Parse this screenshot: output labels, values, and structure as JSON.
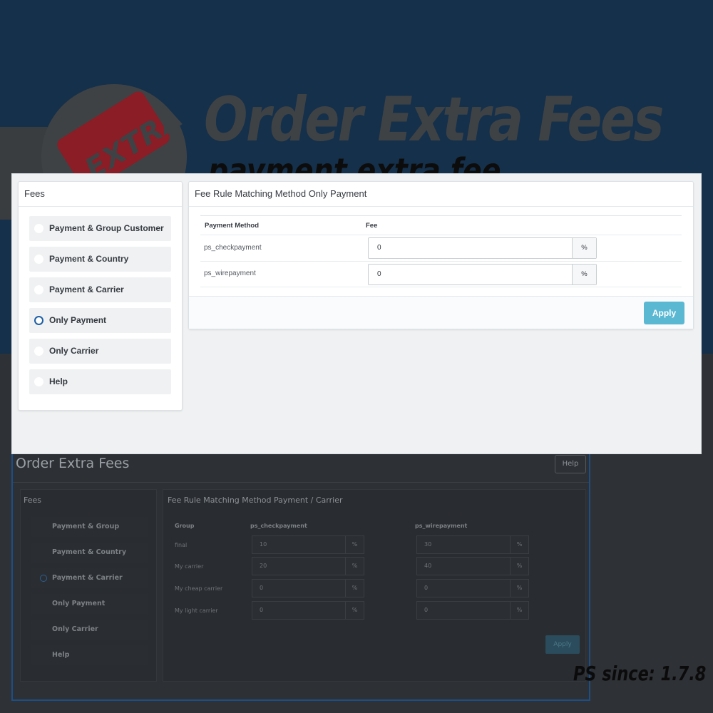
{
  "banner": {
    "logo_text": "EXTRA",
    "title": "Order Extra Fees",
    "subtitle": "payment extra fee"
  },
  "background_admin": {
    "title": "Order Extra Fees",
    "help_label": "Help",
    "fees_heading": "Fees",
    "fee_items": [
      "Payment & Group Customer",
      "Payment & Country",
      "Payment & Carrier",
      "Only Payment",
      "Only Carrier",
      "Help"
    ],
    "selected_index": 2,
    "panel_heading": "Fee Rule Matching Method Payment / Carrier",
    "columns": [
      "Group",
      "ps_checkpayment",
      "ps_wirepayment"
    ],
    "rows": [
      {
        "group": "final",
        "check": "10",
        "wire": "30"
      },
      {
        "group": "My carrier",
        "check": "20",
        "wire": "40"
      },
      {
        "group": "My cheap carrier",
        "check": "0",
        "wire": "0"
      },
      {
        "group": "My light carrier",
        "check": "0",
        "wire": "0"
      }
    ],
    "unit": "%",
    "apply_label": "Apply"
  },
  "footer_note": "PS since: 1.7.8",
  "screenshot": {
    "fees_heading": "Fees",
    "fee_items": [
      {
        "label": "Payment & Group Customer",
        "selected": false
      },
      {
        "label": "Payment & Country",
        "selected": false
      },
      {
        "label": "Payment & Carrier",
        "selected": false
      },
      {
        "label": "Only Payment",
        "selected": true
      },
      {
        "label": "Only Carrier",
        "selected": false
      },
      {
        "label": "Help",
        "selected": false
      }
    ],
    "panel_heading": "Fee Rule Matching Method Only Payment",
    "col_payment": "Payment Method",
    "col_fee": "Fee",
    "rows": [
      {
        "method": "ps_checkpayment",
        "value": "0",
        "unit": "%"
      },
      {
        "method": "ps_wirepayment",
        "value": "0",
        "unit": "%"
      }
    ],
    "apply_label": "Apply"
  },
  "colors": {
    "banner_bg": "#15304a",
    "selected_radio": "#1f5fa6",
    "apply_button": "#5bb8d3"
  }
}
